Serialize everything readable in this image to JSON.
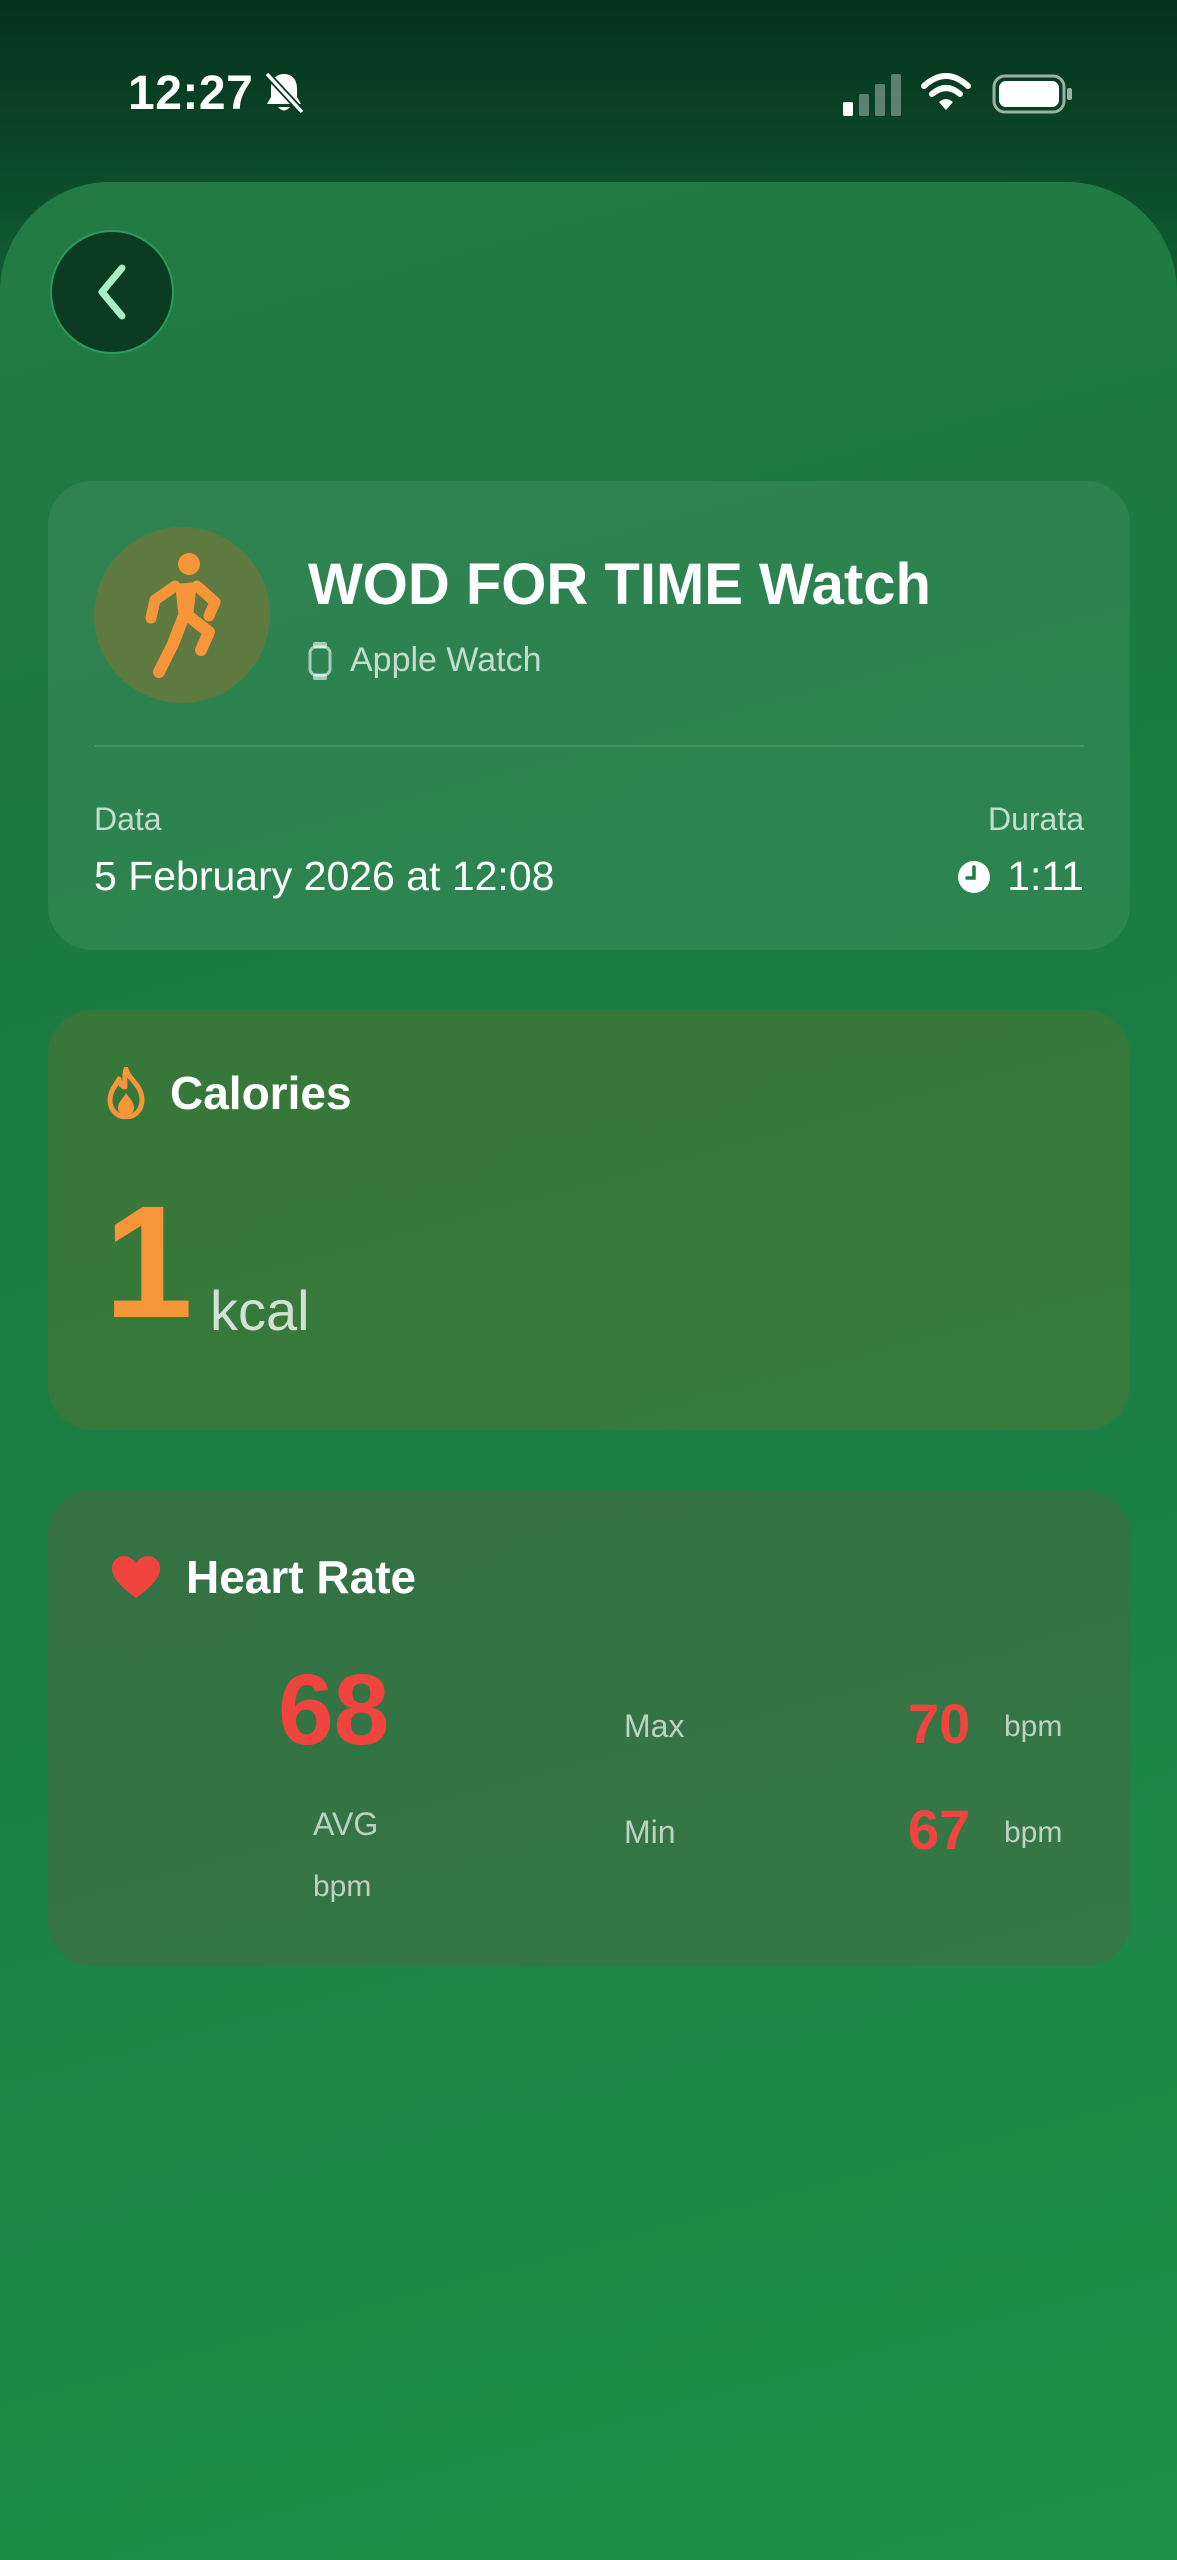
{
  "status_bar": {
    "time": "12:27",
    "icons": [
      "bell-slash-icon",
      "cellular-signal-icon",
      "wifi-icon",
      "battery-icon"
    ]
  },
  "nav": {
    "back_icon": "chevron-left-icon"
  },
  "workout": {
    "activity_icon": "running-figure-icon",
    "title": "WOD FOR TIME Watch",
    "source_icon": "apple-watch-icon",
    "source": "Apple Watch",
    "date_label": "Data",
    "date_value": "5 February 2026 at 12:08",
    "duration_label": "Durata",
    "duration_icon": "clock-icon",
    "duration_value": "1:11"
  },
  "calories": {
    "icon": "flame-icon",
    "title": "Calories",
    "value": "1",
    "unit": "kcal"
  },
  "heart_rate": {
    "icon": "heart-icon",
    "title": "Heart Rate",
    "avg_value": "68",
    "avg_label": "AVG",
    "avg_unit": "bpm",
    "max_label": "Max",
    "max_value": "70",
    "max_unit": "bpm",
    "min_label": "Min",
    "min_value": "67",
    "min_unit": "bpm"
  },
  "colors": {
    "accent_orange": "#f7953b",
    "heart_red": "#f0453f",
    "background_green": "#1a8145"
  }
}
